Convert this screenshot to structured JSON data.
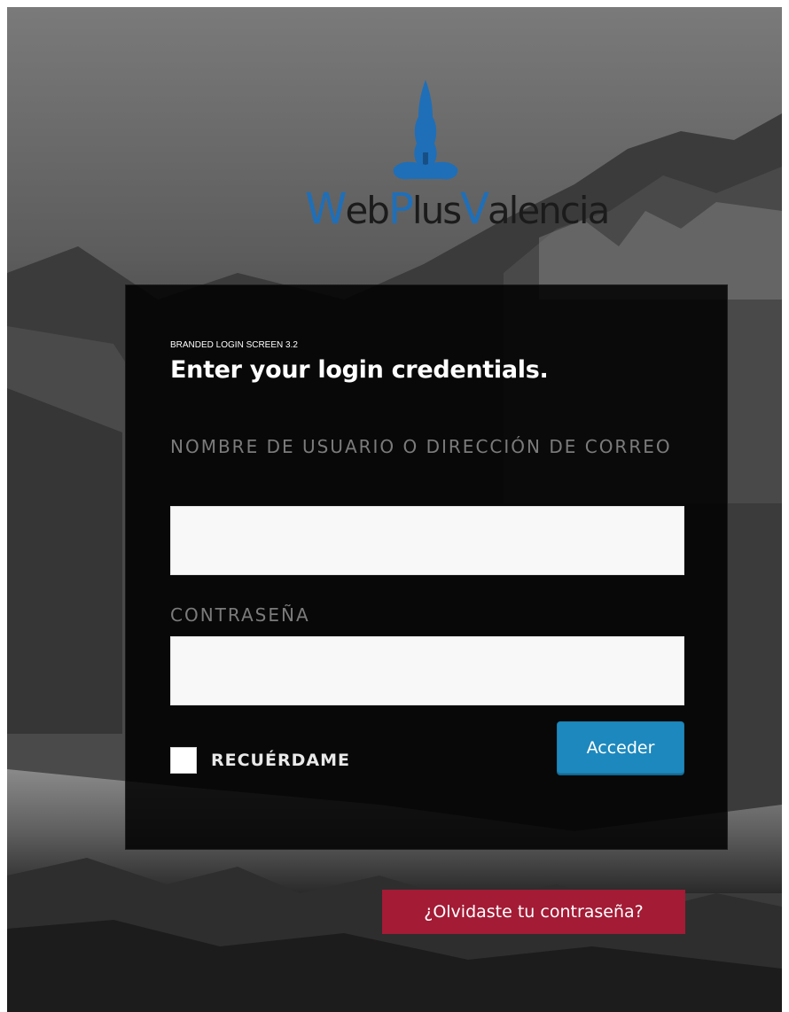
{
  "brand": {
    "logo_text_parts": [
      {
        "text": "W",
        "accent": true
      },
      {
        "text": "eb",
        "accent": false
      },
      {
        "text": "P",
        "accent": true
      },
      {
        "text": "lus",
        "accent": false
      },
      {
        "text": "V",
        "accent": true
      },
      {
        "text": "alencia",
        "accent": false
      }
    ],
    "logo_icon": "pine-tree-logo-icon",
    "accent_color": "#1f6fb8"
  },
  "login": {
    "eyebrow": "BRANDED LOGIN SCREEN 3.2",
    "title": "Enter your login credentials.",
    "username_label": "NOMBRE DE USUARIO O DIRECCIÓN DE CORREO",
    "username_value": "",
    "password_label": "CONTRASEÑA",
    "password_value": "",
    "remember_label": "RECUÉRDAME",
    "remember_checked": false,
    "submit_label": "Acceder",
    "submit_color": "#1d88bd"
  },
  "footer": {
    "lost_password_label": "¿Olvidaste tu contraseña?",
    "lost_password_color": "#a31b35"
  }
}
